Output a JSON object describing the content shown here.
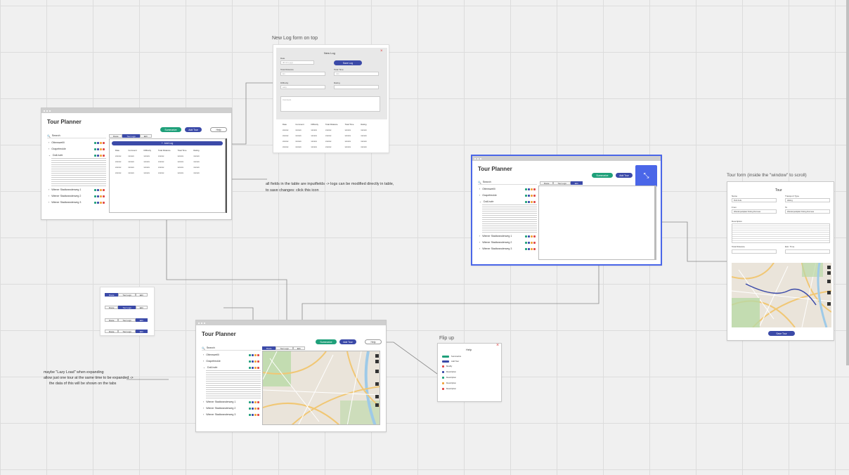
{
  "labels": {
    "new_log": "New Log form on top",
    "tour_form": "Tour form (inside the \"window\" to scroll)",
    "flip_up": "Flip up",
    "table_note_1": "all fields in the table are inputfields -> logs can be modified directly in table,",
    "table_note_2": "to save changes: click this icon",
    "lazy_1": "maybe \"Lazy Load\" when expanding",
    "lazy_2": "allow just one tour at the same time to be expanded ->",
    "lazy_3": "the data of this will be shown on the tabs"
  },
  "app": {
    "title": "Tour Planner",
    "summarize": "Summarize",
    "add_tour": "Add Tour",
    "help": "Help",
    "search": "Search",
    "tabs": [
      "Route",
      "Tour Logs",
      "Edit"
    ],
    "tours": [
      "Ottensweilli",
      "Grapefreckle",
      "Doll-hofe"
    ],
    "tours_more": [
      "Wiener Stadtwanderweg 1",
      "Wiener Stadtwanderweg 2",
      "Wiener Stadtwanderweg 3"
    ],
    "add_log": "Add Log"
  },
  "log_table": {
    "headers": [
      "Date",
      "Comment",
      "Difficulty",
      "Total Distance",
      "Total Time",
      "Rating"
    ],
    "cell": "xxxxxx"
  },
  "new_log_form": {
    "title": "New Log",
    "date": "Date",
    "date_ph": "dd.mm.yyyy",
    "save": "Save Log",
    "total_distance": "Total Distance",
    "total_time": "Total Time",
    "difficulty": "Difficulty",
    "rating": "Rating",
    "comment": "Comment",
    "km": "km",
    "min": "min",
    "easy": "easy"
  },
  "tour_form": {
    "title": "Tour",
    "name": "Name",
    "name_val": "Doll-hofe",
    "transport": "Transport Type",
    "transport_val": "Hiking",
    "from": "From",
    "from_val": "Wanderparkplatz Doling Dorneau",
    "to": "To",
    "to_val": "Wanderparkplatz Doling Dorneau",
    "description": "Description",
    "total_distance": "Total Distance",
    "est_time": "Estr. Time",
    "save": "Save Tour"
  },
  "help": {
    "title": "Help",
    "items": [
      "Summarize",
      "Add Tour",
      "Modify",
      "Description",
      "Description",
      "Description",
      "Description"
    ]
  },
  "colors": {
    "accent": "#3b4aa8",
    "teal": "#1fa07a",
    "selection": "#4a66e8"
  }
}
